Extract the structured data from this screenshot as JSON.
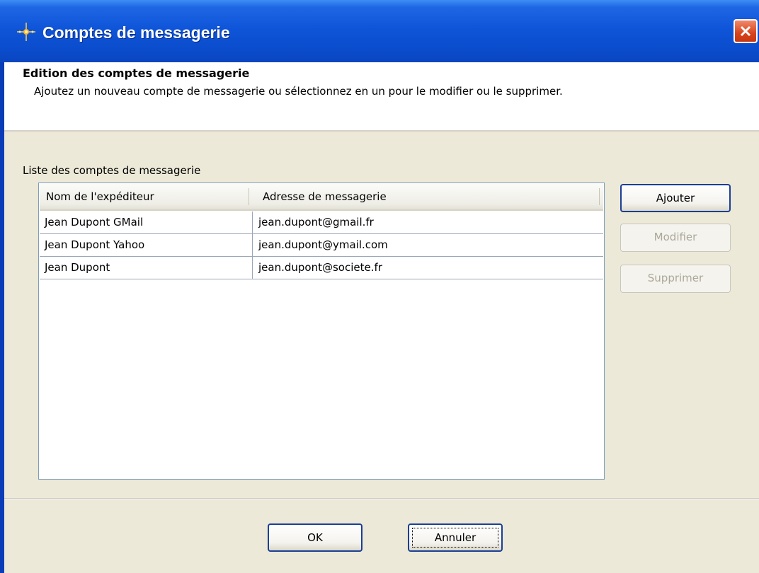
{
  "window": {
    "title": "Comptes de messagerie",
    "icon": "app-sparkle-icon",
    "close_icon": "close-icon"
  },
  "header": {
    "title": "Edition des comptes de messagerie",
    "description": "Ajoutez un nouveau compte de messagerie ou sélectionnez en un pour le modifier ou le supprimer."
  },
  "accounts": {
    "label": "Liste des comptes de messagerie",
    "columns": [
      "Nom de l'expéditeur",
      "Adresse de messagerie"
    ],
    "rows": [
      {
        "name": "Jean Dupont GMail",
        "email": "jean.dupont@gmail.fr"
      },
      {
        "name": "Jean Dupont Yahoo",
        "email": "jean.dupont@ymail.com"
      },
      {
        "name": "Jean Dupont",
        "email": "jean.dupont@societe.fr"
      }
    ]
  },
  "actions": {
    "add": "Ajouter",
    "edit": "Modifier",
    "delete": "Supprimer"
  },
  "footer": {
    "ok": "OK",
    "cancel": "Annuler"
  },
  "colors": {
    "titlebar": "#0a4ccc",
    "dialog_bg": "#ece9d8",
    "close_button": "#d7441c"
  }
}
